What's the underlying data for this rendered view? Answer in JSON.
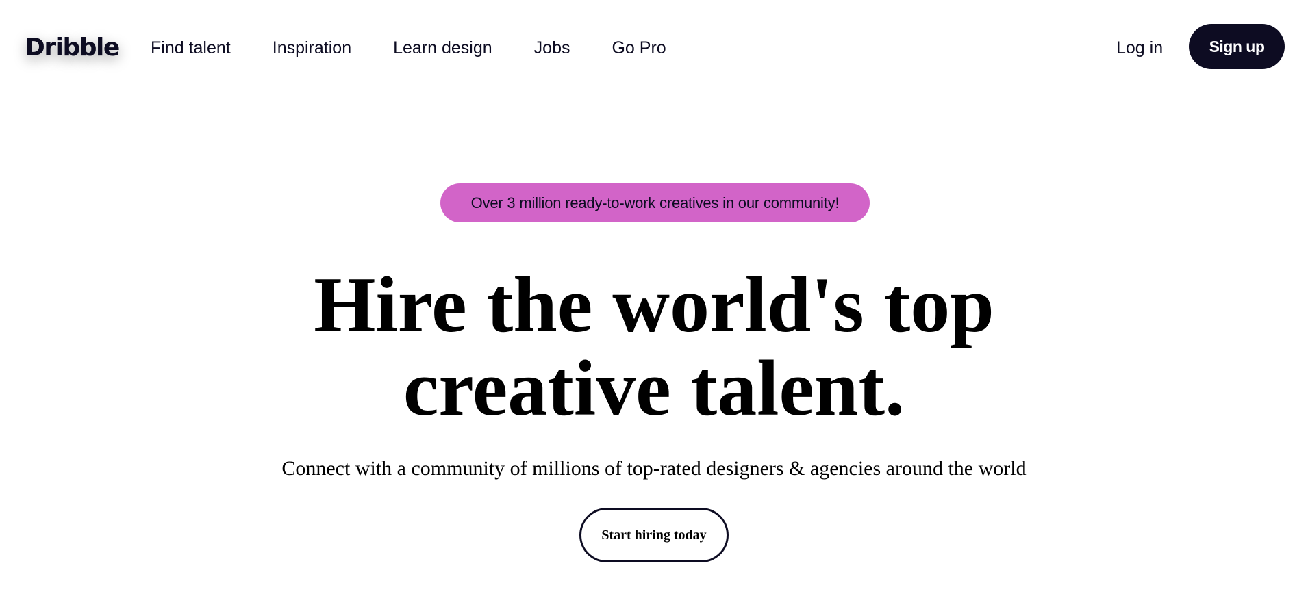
{
  "header": {
    "logo": "Dribble",
    "nav": [
      {
        "label": "Find talent"
      },
      {
        "label": "Inspiration"
      },
      {
        "label": "Learn design"
      },
      {
        "label": "Jobs"
      },
      {
        "label": "Go Pro"
      }
    ],
    "login_label": "Log in",
    "signup_label": "Sign up"
  },
  "hero": {
    "badge": "Over 3 million ready-to-work creatives in our community!",
    "headline_line1": "Hire the world's top",
    "headline_line2": "creative talent.",
    "subheadline": "Connect with a community of millions of top-rated designers & agencies around the world",
    "cta_label": "Start hiring today"
  },
  "colors": {
    "badge_background": "#d264c8",
    "primary_dark": "#0d0c22",
    "page_background": "#ffffff"
  }
}
